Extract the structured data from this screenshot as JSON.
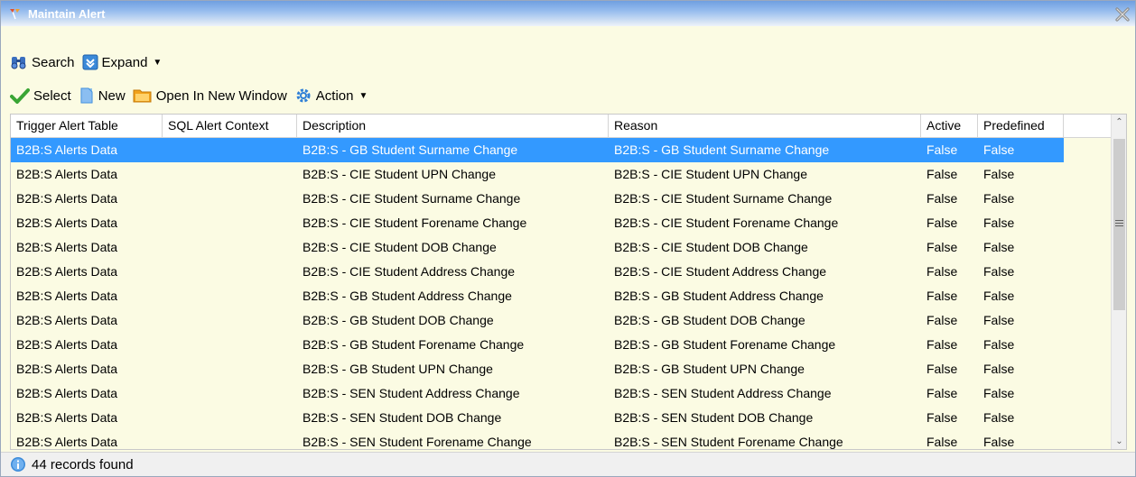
{
  "window": {
    "title": "Maintain Alert"
  },
  "toolbar1": {
    "search_label": "Search",
    "expand_label": "Expand"
  },
  "toolbar2": {
    "select_label": "Select",
    "new_label": "New",
    "open_new_window_label": "Open In New Window",
    "action_label": "Action"
  },
  "grid": {
    "columns": [
      "Trigger Alert Table",
      "SQL Alert Context",
      "Description",
      "Reason",
      "Active",
      "Predefined"
    ],
    "rows": [
      [
        "B2B:S Alerts Data",
        "",
        "B2B:S - GB Student Surname Change",
        "B2B:S - GB Student Surname Change",
        "False",
        "False"
      ],
      [
        "B2B:S Alerts Data",
        "",
        "B2B:S - CIE Student UPN Change",
        "B2B:S - CIE Student UPN Change",
        "False",
        "False"
      ],
      [
        "B2B:S Alerts Data",
        "",
        "B2B:S - CIE Student Surname Change",
        "B2B:S - CIE Student Surname Change",
        "False",
        "False"
      ],
      [
        "B2B:S Alerts Data",
        "",
        "B2B:S - CIE Student Forename Change",
        "B2B:S - CIE Student Forename Change",
        "False",
        "False"
      ],
      [
        "B2B:S Alerts Data",
        "",
        "B2B:S - CIE Student DOB Change",
        "B2B:S - CIE Student DOB Change",
        "False",
        "False"
      ],
      [
        "B2B:S Alerts Data",
        "",
        "B2B:S - CIE Student Address Change",
        "B2B:S - CIE Student Address Change",
        "False",
        "False"
      ],
      [
        "B2B:S Alerts Data",
        "",
        "B2B:S - GB Student Address Change",
        "B2B:S - GB Student Address Change",
        "False",
        "False"
      ],
      [
        "B2B:S Alerts Data",
        "",
        "B2B:S - GB Student DOB Change",
        "B2B:S - GB Student DOB Change",
        "False",
        "False"
      ],
      [
        "B2B:S Alerts Data",
        "",
        "B2B:S - GB Student Forename Change",
        "B2B:S - GB Student Forename Change",
        "False",
        "False"
      ],
      [
        "B2B:S Alerts Data",
        "",
        "B2B:S - GB Student UPN Change",
        "B2B:S - GB Student UPN Change",
        "False",
        "False"
      ],
      [
        "B2B:S Alerts Data",
        "",
        "B2B:S - SEN Student Address Change",
        "B2B:S - SEN Student Address Change",
        "False",
        "False"
      ],
      [
        "B2B:S Alerts Data",
        "",
        "B2B:S - SEN Student DOB Change",
        "B2B:S - SEN Student DOB Change",
        "False",
        "False"
      ],
      [
        "B2B:S Alerts Data",
        "",
        "B2B:S - SEN Student Forename Change",
        "B2B:S - SEN Student Forename Change",
        "False",
        "False"
      ]
    ],
    "selected_row": 0
  },
  "status": {
    "text": "44 records found"
  },
  "colors": {
    "selection": "#3399ff",
    "background": "#fbfbe3",
    "title_gradient_top": "#6f9fe0"
  },
  "icons": {
    "title": "flag-icon",
    "close": "close-icon",
    "search": "binoculars-icon",
    "expand": "expand-icon",
    "select": "checkmark-icon",
    "new": "new-document-icon",
    "open": "folder-icon",
    "action": "gear-icon",
    "status": "info-icon"
  }
}
